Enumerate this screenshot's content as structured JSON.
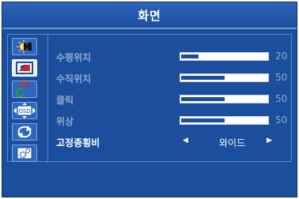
{
  "title": "화면",
  "colors": {
    "panel": "#1b4e9c",
    "slider_track": "#ffffff",
    "label_inactive": "#8fa8d4",
    "label_active": "#ffffff"
  },
  "sidebar": {
    "items": [
      {
        "icon": "brightness-icon"
      },
      {
        "icon": "image-display-icon",
        "selected": true
      },
      {
        "icon": "color-icon"
      },
      {
        "icon": "osd-icon",
        "text": "OSD"
      },
      {
        "icon": "reset-icon"
      },
      {
        "icon": "settings-icon"
      }
    ]
  },
  "settings": [
    {
      "label": "수평위치",
      "value": "20",
      "level": 0.2
    },
    {
      "label": "수직위치",
      "value": "50",
      "level": 0.5
    },
    {
      "label": "클릭",
      "value": "50",
      "level": 0.5
    },
    {
      "label": "위상",
      "value": "50",
      "level": 0.5
    },
    {
      "label": "고정종횡비",
      "option": "와이드",
      "left_arrow": "◀",
      "right_arrow": "▶"
    }
  ]
}
